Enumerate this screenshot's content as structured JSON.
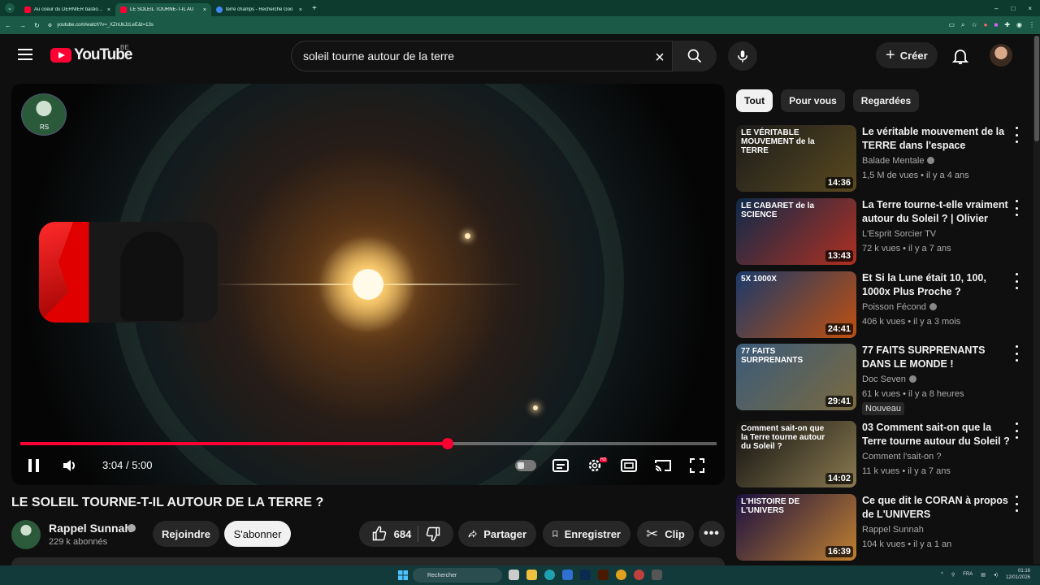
{
  "browser": {
    "tabs": [
      {
        "title": "Au coeur du DERNIER bastion o",
        "close": "×",
        "color": "#ff0033"
      },
      {
        "title": "LE SOLEIL TOURNE-T-IL AU",
        "close": "×",
        "color": "#ff0033"
      },
      {
        "title": "terre champs - Recherche Goo",
        "close": "×",
        "color": "#4285f4"
      }
    ],
    "new_tab": "+",
    "url": "youtube.com/watch?v=_XZnUkJzLeE&t=13s",
    "window_controls": [
      "–",
      "□",
      "×"
    ]
  },
  "header": {
    "logo_text": "YouTube",
    "country_code": "BE",
    "search_value": "soleil tourne autour de la terre",
    "clear_label": "×",
    "create_label": "Créer"
  },
  "player": {
    "current_time": "3:04",
    "separator": "/",
    "duration": "5:00",
    "progress_fraction": 0.6133,
    "watermark": "RS",
    "hd_badge": "HD"
  },
  "video": {
    "title": "LE SOLEIL TOURNE-T-IL AUTOUR DE LA TERRE ?",
    "channel": "Rappel Sunnah",
    "subscribers": "229 k abonnés",
    "join_label": "Rejoindre",
    "subscribe_label": "S'abonner",
    "likes": "684",
    "share_label": "Partager",
    "save_label": "Enregistrer",
    "clip_label": "Clip"
  },
  "sidebar": {
    "chips": [
      "Tout",
      "Pour vous",
      "Regardées"
    ],
    "recommendations": [
      {
        "title": "Le véritable mouvement de la TERRE dans l'espace",
        "channel": "Balade Mentale",
        "verified": true,
        "meta": "1,5 M de vues • il y a 4 ans",
        "duration": "14:36",
        "thumb_text": "LE VÉRITABLE MOUVEMENT de la TERRE",
        "colors": [
          "#1b1b1b",
          "#5a4a20"
        ]
      },
      {
        "title": "La Terre tourne-t-elle vraiment autour du Soleil ? | Olivier Jam...",
        "channel": "L'Esprit Sorcier TV",
        "verified": false,
        "meta": "72 k vues • il y a 7 ans",
        "duration": "13:43",
        "thumb_text": "LE CABARET de la SCIENCE",
        "colors": [
          "#0d2a4a",
          "#b03020"
        ]
      },
      {
        "title": "Et Si la Lune était 10, 100, 1000x Plus Proche ?",
        "channel": "Poisson Fécond",
        "verified": true,
        "meta": "406 k vues • il y a 3 mois",
        "duration": "24:41",
        "thumb_text": "5X 1000X",
        "colors": [
          "#1a3a6a",
          "#c05010"
        ]
      },
      {
        "title": "77 FAITS SURPRENANTS DANS LE MONDE !",
        "channel": "Doc Seven",
        "verified": true,
        "meta": "61 k vues • il y a 8 heures",
        "duration": "29:41",
        "thumb_text": "77 FAITS SURPRENANTS",
        "colors": [
          "#3a5a7a",
          "#7a6a40"
        ],
        "badge": "Nouveau"
      },
      {
        "title": "03 Comment sait-on que la Terre tourne autour du Soleil ?",
        "channel": "Comment l'sait-on ?",
        "verified": false,
        "meta": "11 k vues • il y a 7 ans",
        "duration": "14:02",
        "thumb_text": "Comment sait-on que la Terre tourne autour du Soleil ?",
        "colors": [
          "#101010",
          "#8a7a50"
        ]
      },
      {
        "title": "Ce que dit le CORAN à propos de L'UNIVERS",
        "channel": "Rappel Sunnah",
        "verified": false,
        "meta": "104 k vues • il y a 1 an",
        "duration": "16:39",
        "thumb_text": "L'HISTOIRE DE L'UNIVERS",
        "colors": [
          "#1a1040",
          "#c08030"
        ]
      }
    ]
  },
  "taskbar": {
    "search_placeholder": "Rechercher",
    "lang": "FRA",
    "time": "01:16",
    "date": "12/01/2026"
  }
}
